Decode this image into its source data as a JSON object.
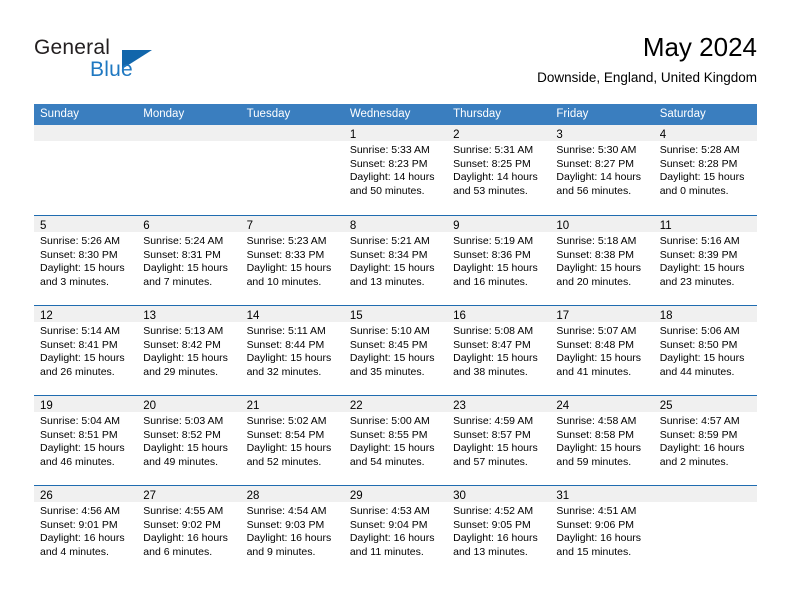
{
  "brand": {
    "name_part1": "General",
    "name_part2": "Blue",
    "logo_icon": "triangle-logo-icon"
  },
  "header": {
    "title": "May 2024",
    "location": "Downside, England, United Kingdom"
  },
  "colors": {
    "header_blue": "#3a7ebf",
    "row_divider_blue": "#1f6cb0",
    "day_strip_gray": "#f0f0f0",
    "brand_blue": "#1f78c1",
    "logo_blue": "#1266ab"
  },
  "weekdays": [
    "Sunday",
    "Monday",
    "Tuesday",
    "Wednesday",
    "Thursday",
    "Friday",
    "Saturday"
  ],
  "weeks": [
    [
      {
        "day": "",
        "empty": true,
        "sunrise": "",
        "sunset": "",
        "daylight1": "",
        "daylight2": ""
      },
      {
        "day": "",
        "empty": true,
        "sunrise": "",
        "sunset": "",
        "daylight1": "",
        "daylight2": ""
      },
      {
        "day": "",
        "empty": true,
        "sunrise": "",
        "sunset": "",
        "daylight1": "",
        "daylight2": ""
      },
      {
        "day": "1",
        "empty": false,
        "sunrise": "Sunrise: 5:33 AM",
        "sunset": "Sunset: 8:23 PM",
        "daylight1": "Daylight: 14 hours",
        "daylight2": "and 50 minutes."
      },
      {
        "day": "2",
        "empty": false,
        "sunrise": "Sunrise: 5:31 AM",
        "sunset": "Sunset: 8:25 PM",
        "daylight1": "Daylight: 14 hours",
        "daylight2": "and 53 minutes."
      },
      {
        "day": "3",
        "empty": false,
        "sunrise": "Sunrise: 5:30 AM",
        "sunset": "Sunset: 8:27 PM",
        "daylight1": "Daylight: 14 hours",
        "daylight2": "and 56 minutes."
      },
      {
        "day": "4",
        "empty": false,
        "sunrise": "Sunrise: 5:28 AM",
        "sunset": "Sunset: 8:28 PM",
        "daylight1": "Daylight: 15 hours",
        "daylight2": "and 0 minutes."
      }
    ],
    [
      {
        "day": "5",
        "empty": false,
        "sunrise": "Sunrise: 5:26 AM",
        "sunset": "Sunset: 8:30 PM",
        "daylight1": "Daylight: 15 hours",
        "daylight2": "and 3 minutes."
      },
      {
        "day": "6",
        "empty": false,
        "sunrise": "Sunrise: 5:24 AM",
        "sunset": "Sunset: 8:31 PM",
        "daylight1": "Daylight: 15 hours",
        "daylight2": "and 7 minutes."
      },
      {
        "day": "7",
        "empty": false,
        "sunrise": "Sunrise: 5:23 AM",
        "sunset": "Sunset: 8:33 PM",
        "daylight1": "Daylight: 15 hours",
        "daylight2": "and 10 minutes."
      },
      {
        "day": "8",
        "empty": false,
        "sunrise": "Sunrise: 5:21 AM",
        "sunset": "Sunset: 8:34 PM",
        "daylight1": "Daylight: 15 hours",
        "daylight2": "and 13 minutes."
      },
      {
        "day": "9",
        "empty": false,
        "sunrise": "Sunrise: 5:19 AM",
        "sunset": "Sunset: 8:36 PM",
        "daylight1": "Daylight: 15 hours",
        "daylight2": "and 16 minutes."
      },
      {
        "day": "10",
        "empty": false,
        "sunrise": "Sunrise: 5:18 AM",
        "sunset": "Sunset: 8:38 PM",
        "daylight1": "Daylight: 15 hours",
        "daylight2": "and 20 minutes."
      },
      {
        "day": "11",
        "empty": false,
        "sunrise": "Sunrise: 5:16 AM",
        "sunset": "Sunset: 8:39 PM",
        "daylight1": "Daylight: 15 hours",
        "daylight2": "and 23 minutes."
      }
    ],
    [
      {
        "day": "12",
        "empty": false,
        "sunrise": "Sunrise: 5:14 AM",
        "sunset": "Sunset: 8:41 PM",
        "daylight1": "Daylight: 15 hours",
        "daylight2": "and 26 minutes."
      },
      {
        "day": "13",
        "empty": false,
        "sunrise": "Sunrise: 5:13 AM",
        "sunset": "Sunset: 8:42 PM",
        "daylight1": "Daylight: 15 hours",
        "daylight2": "and 29 minutes."
      },
      {
        "day": "14",
        "empty": false,
        "sunrise": "Sunrise: 5:11 AM",
        "sunset": "Sunset: 8:44 PM",
        "daylight1": "Daylight: 15 hours",
        "daylight2": "and 32 minutes."
      },
      {
        "day": "15",
        "empty": false,
        "sunrise": "Sunrise: 5:10 AM",
        "sunset": "Sunset: 8:45 PM",
        "daylight1": "Daylight: 15 hours",
        "daylight2": "and 35 minutes."
      },
      {
        "day": "16",
        "empty": false,
        "sunrise": "Sunrise: 5:08 AM",
        "sunset": "Sunset: 8:47 PM",
        "daylight1": "Daylight: 15 hours",
        "daylight2": "and 38 minutes."
      },
      {
        "day": "17",
        "empty": false,
        "sunrise": "Sunrise: 5:07 AM",
        "sunset": "Sunset: 8:48 PM",
        "daylight1": "Daylight: 15 hours",
        "daylight2": "and 41 minutes."
      },
      {
        "day": "18",
        "empty": false,
        "sunrise": "Sunrise: 5:06 AM",
        "sunset": "Sunset: 8:50 PM",
        "daylight1": "Daylight: 15 hours",
        "daylight2": "and 44 minutes."
      }
    ],
    [
      {
        "day": "19",
        "empty": false,
        "sunrise": "Sunrise: 5:04 AM",
        "sunset": "Sunset: 8:51 PM",
        "daylight1": "Daylight: 15 hours",
        "daylight2": "and 46 minutes."
      },
      {
        "day": "20",
        "empty": false,
        "sunrise": "Sunrise: 5:03 AM",
        "sunset": "Sunset: 8:52 PM",
        "daylight1": "Daylight: 15 hours",
        "daylight2": "and 49 minutes."
      },
      {
        "day": "21",
        "empty": false,
        "sunrise": "Sunrise: 5:02 AM",
        "sunset": "Sunset: 8:54 PM",
        "daylight1": "Daylight: 15 hours",
        "daylight2": "and 52 minutes."
      },
      {
        "day": "22",
        "empty": false,
        "sunrise": "Sunrise: 5:00 AM",
        "sunset": "Sunset: 8:55 PM",
        "daylight1": "Daylight: 15 hours",
        "daylight2": "and 54 minutes."
      },
      {
        "day": "23",
        "empty": false,
        "sunrise": "Sunrise: 4:59 AM",
        "sunset": "Sunset: 8:57 PM",
        "daylight1": "Daylight: 15 hours",
        "daylight2": "and 57 minutes."
      },
      {
        "day": "24",
        "empty": false,
        "sunrise": "Sunrise: 4:58 AM",
        "sunset": "Sunset: 8:58 PM",
        "daylight1": "Daylight: 15 hours",
        "daylight2": "and 59 minutes."
      },
      {
        "day": "25",
        "empty": false,
        "sunrise": "Sunrise: 4:57 AM",
        "sunset": "Sunset: 8:59 PM",
        "daylight1": "Daylight: 16 hours",
        "daylight2": "and 2 minutes."
      }
    ],
    [
      {
        "day": "26",
        "empty": false,
        "sunrise": "Sunrise: 4:56 AM",
        "sunset": "Sunset: 9:01 PM",
        "daylight1": "Daylight: 16 hours",
        "daylight2": "and 4 minutes."
      },
      {
        "day": "27",
        "empty": false,
        "sunrise": "Sunrise: 4:55 AM",
        "sunset": "Sunset: 9:02 PM",
        "daylight1": "Daylight: 16 hours",
        "daylight2": "and 6 minutes."
      },
      {
        "day": "28",
        "empty": false,
        "sunrise": "Sunrise: 4:54 AM",
        "sunset": "Sunset: 9:03 PM",
        "daylight1": "Daylight: 16 hours",
        "daylight2": "and 9 minutes."
      },
      {
        "day": "29",
        "empty": false,
        "sunrise": "Sunrise: 4:53 AM",
        "sunset": "Sunset: 9:04 PM",
        "daylight1": "Daylight: 16 hours",
        "daylight2": "and 11 minutes."
      },
      {
        "day": "30",
        "empty": false,
        "sunrise": "Sunrise: 4:52 AM",
        "sunset": "Sunset: 9:05 PM",
        "daylight1": "Daylight: 16 hours",
        "daylight2": "and 13 minutes."
      },
      {
        "day": "31",
        "empty": false,
        "sunrise": "Sunrise: 4:51 AM",
        "sunset": "Sunset: 9:06 PM",
        "daylight1": "Daylight: 16 hours",
        "daylight2": "and 15 minutes."
      },
      {
        "day": "",
        "empty": true,
        "sunrise": "",
        "sunset": "",
        "daylight1": "",
        "daylight2": ""
      }
    ]
  ]
}
